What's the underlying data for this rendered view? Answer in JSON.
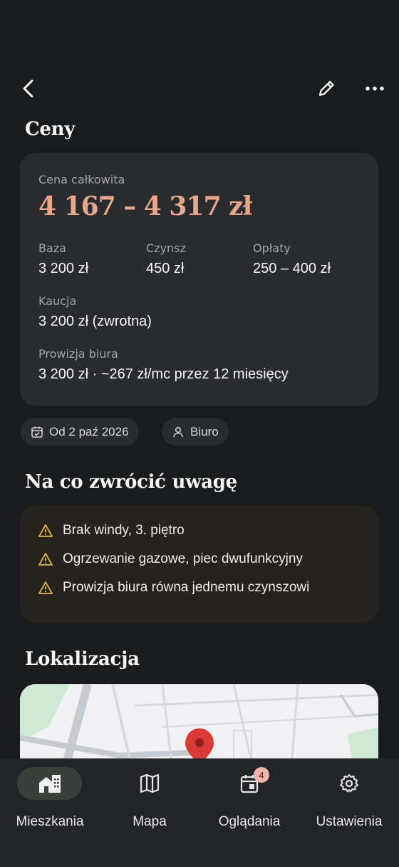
{
  "prices": {
    "section_title": "Ceny",
    "total_label": "Cena całkowita",
    "total_value": "4 167 – 4 317 zł",
    "base_label": "Baza",
    "base_value": "3 200 zł",
    "rent_label": "Czynsz",
    "rent_value": "450 zł",
    "fees_label": "Opłaty",
    "fees_value": "250 – 400 zł",
    "deposit_label": "Kaucja",
    "deposit_value": "3 200 zł (zwrotna)",
    "commission_label": "Prowizja biura",
    "commission_value": "3 200 zł · ~267 zł/mc przez 12 miesięcy"
  },
  "chips": {
    "available_from": "Od 2 paź 2026",
    "agency": "Biuro"
  },
  "warnings": {
    "section_title": "Na co zwrócić uwagę",
    "items": [
      "Brak windy, 3. piętro",
      "Ogrzewanie gazowe, piec dwufunkcyjny",
      "Prowizja biura równa jednemu czynszowi"
    ],
    "icon": "warning-triangle-icon",
    "icon_color": "#e0b24a"
  },
  "location": {
    "section_title": "Lokalizacja"
  },
  "nav": {
    "items": [
      {
        "label": "Mieszkania",
        "icon": "buildings-icon",
        "active": true
      },
      {
        "label": "Mapa",
        "icon": "map-icon"
      },
      {
        "label": "Oglądania",
        "icon": "calendar-icon",
        "badge": "4"
      },
      {
        "label": "Ustawienia",
        "icon": "gear-icon"
      }
    ]
  },
  "colors": {
    "accent_price": "#e6a78a",
    "background": "#1a1b1d",
    "card": "#2a2b2e",
    "map_pin": "#d93a36"
  }
}
